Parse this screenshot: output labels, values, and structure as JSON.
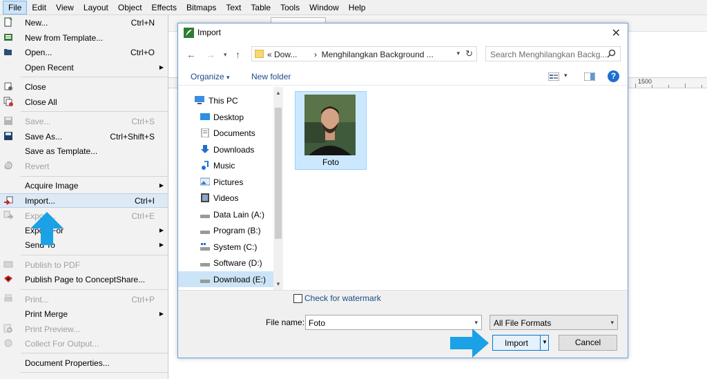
{
  "menubar": {
    "items": [
      {
        "label": "File",
        "active": true
      },
      {
        "label": "Edit"
      },
      {
        "label": "View"
      },
      {
        "label": "Layout"
      },
      {
        "label": "Object"
      },
      {
        "label": "Effects"
      },
      {
        "label": "Bitmaps"
      },
      {
        "label": "Text"
      },
      {
        "label": "Table"
      },
      {
        "label": "Tools"
      },
      {
        "label": "Window"
      },
      {
        "label": "Help"
      }
    ]
  },
  "file_menu": {
    "items": [
      {
        "label": "New...",
        "shortcut": "Ctrl+N",
        "icon": "new-document-icon"
      },
      {
        "label": "New from Template...",
        "shortcut": "",
        "icon": "template-icon"
      },
      {
        "label": "Open...",
        "shortcut": "Ctrl+O",
        "icon": "open-folder-icon"
      },
      {
        "label": "Open Recent",
        "shortcut": "",
        "submenu": true
      },
      {
        "label": "Close",
        "shortcut": "",
        "icon": "close-document-icon"
      },
      {
        "label": "Close All",
        "shortcut": "",
        "icon": "close-all-icon"
      },
      {
        "label": "Save...",
        "shortcut": "Ctrl+S",
        "disabled": true,
        "icon": "save-icon"
      },
      {
        "label": "Save As...",
        "shortcut": "Ctrl+Shift+S",
        "icon": "save-as-icon"
      },
      {
        "label": "Save as Template...",
        "shortcut": ""
      },
      {
        "label": "Revert",
        "shortcut": "",
        "disabled": true,
        "icon": "revert-icon"
      },
      {
        "label": "Acquire Image",
        "shortcut": "",
        "submenu": true
      },
      {
        "label": "Import...",
        "shortcut": "Ctrl+I",
        "highlighted": true,
        "icon": "import-icon"
      },
      {
        "label": "Export...",
        "shortcut": "Ctrl+E",
        "disabled": true,
        "icon": "export-icon"
      },
      {
        "label": "Export For",
        "shortcut": "",
        "submenu": true
      },
      {
        "label": "Send To",
        "shortcut": "",
        "submenu": true
      },
      {
        "label": "Publish to PDF",
        "shortcut": "",
        "disabled": true,
        "icon": "pdf-icon"
      },
      {
        "label": "Publish Page to ConceptShare...",
        "shortcut": "",
        "icon": "conceptshare-icon"
      },
      {
        "label": "Print...",
        "shortcut": "Ctrl+P",
        "disabled": true,
        "icon": "print-icon"
      },
      {
        "label": "Print Merge",
        "shortcut": "",
        "submenu": true
      },
      {
        "label": "Print Preview...",
        "shortcut": "",
        "disabled": true,
        "icon": "print-preview-icon"
      },
      {
        "label": "Collect For Output...",
        "shortcut": "",
        "disabled": true,
        "icon": "collect-icon"
      },
      {
        "label": "Document Properties...",
        "shortcut": ""
      }
    ]
  },
  "ruler": {
    "label": "1500"
  },
  "dialog": {
    "title": "Import",
    "address": {
      "crumb1": "Dow...",
      "crumb2": "Menghilangkan Background ..."
    },
    "search_placeholder": "Search Menghilangkan Backg...",
    "organize_label": "Organize",
    "new_folder_label": "New folder",
    "help_label": "?",
    "nav_items": [
      {
        "label": "This PC",
        "icon": "computer-icon"
      },
      {
        "label": "Desktop",
        "icon": "desktop-icon"
      },
      {
        "label": "Documents",
        "icon": "documents-icon"
      },
      {
        "label": "Downloads",
        "icon": "downloads-icon"
      },
      {
        "label": "Music",
        "icon": "music-icon"
      },
      {
        "label": "Pictures",
        "icon": "pictures-icon"
      },
      {
        "label": "Videos",
        "icon": "videos-icon"
      },
      {
        "label": "Data Lain (A:)",
        "icon": "drive-icon"
      },
      {
        "label": "Program (B:)",
        "icon": "drive-icon"
      },
      {
        "label": "System (C:)",
        "icon": "system-drive-icon"
      },
      {
        "label": "Software (D:)",
        "icon": "drive-icon"
      },
      {
        "label": "Download (E:)",
        "icon": "drive-icon",
        "selected": true
      }
    ],
    "files": [
      {
        "name": "Foto"
      }
    ],
    "watermark_label": "Check for watermark",
    "file_name_label": "File name:",
    "file_name_value": "Foto",
    "file_format_value": "All File Formats",
    "import_button": "Import",
    "cancel_button": "Cancel"
  },
  "colors": {
    "accent": "#1e6fcf",
    "annotation_arrow": "#1aa1e6",
    "selection": "#cce4f7"
  }
}
